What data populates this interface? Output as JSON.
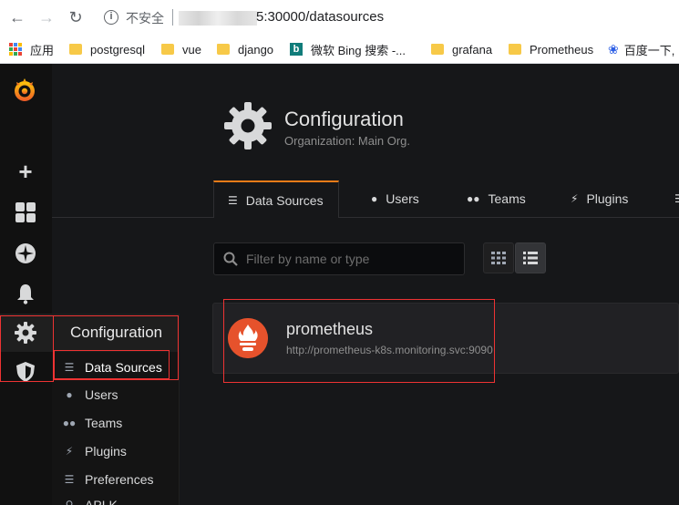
{
  "browser": {
    "insecure_label": "不安全",
    "url": "5:30000/datasources"
  },
  "bookmarks": [
    {
      "label": "应用",
      "icon": "apps-icon"
    },
    {
      "label": "postgresql",
      "icon": "folder-icon"
    },
    {
      "label": "vue",
      "icon": "folder-icon"
    },
    {
      "label": "django",
      "icon": "folder-icon"
    },
    {
      "label": "微软 Bing 搜索 -...",
      "icon": "bing-icon"
    },
    {
      "label": "grafana",
      "icon": "folder-icon"
    },
    {
      "label": "Prometheus",
      "icon": "folder-icon"
    },
    {
      "label": "百度一下,",
      "icon": "baidu-icon"
    }
  ],
  "page": {
    "title": "Configuration",
    "subtitle": "Organization: Main Org."
  },
  "tabs": [
    {
      "label": "Data Sources",
      "icon": "database-icon",
      "active": true
    },
    {
      "label": "Users",
      "icon": "user-icon"
    },
    {
      "label": "Teams",
      "icon": "users-icon"
    },
    {
      "label": "Plugins",
      "icon": "plug-icon"
    }
  ],
  "search": {
    "placeholder": "Filter by name or type"
  },
  "datasource": {
    "name": "prometheus",
    "url": "http://prometheus-k8s.monitoring.svc:9090"
  },
  "flyout": {
    "title": "Configuration",
    "items": [
      {
        "label": "Data Sources",
        "icon": "database-icon"
      },
      {
        "label": "Users",
        "icon": "user-icon"
      },
      {
        "label": "Teams",
        "icon": "users-icon"
      },
      {
        "label": "Plugins",
        "icon": "plug-icon"
      },
      {
        "label": "Preferences",
        "icon": "sliders-icon"
      },
      {
        "label": "API K...",
        "icon": "key-icon"
      }
    ]
  },
  "colors": {
    "accent": "#eb7b18",
    "prometheus": "#e6522c",
    "annotation": "#ee3333"
  }
}
